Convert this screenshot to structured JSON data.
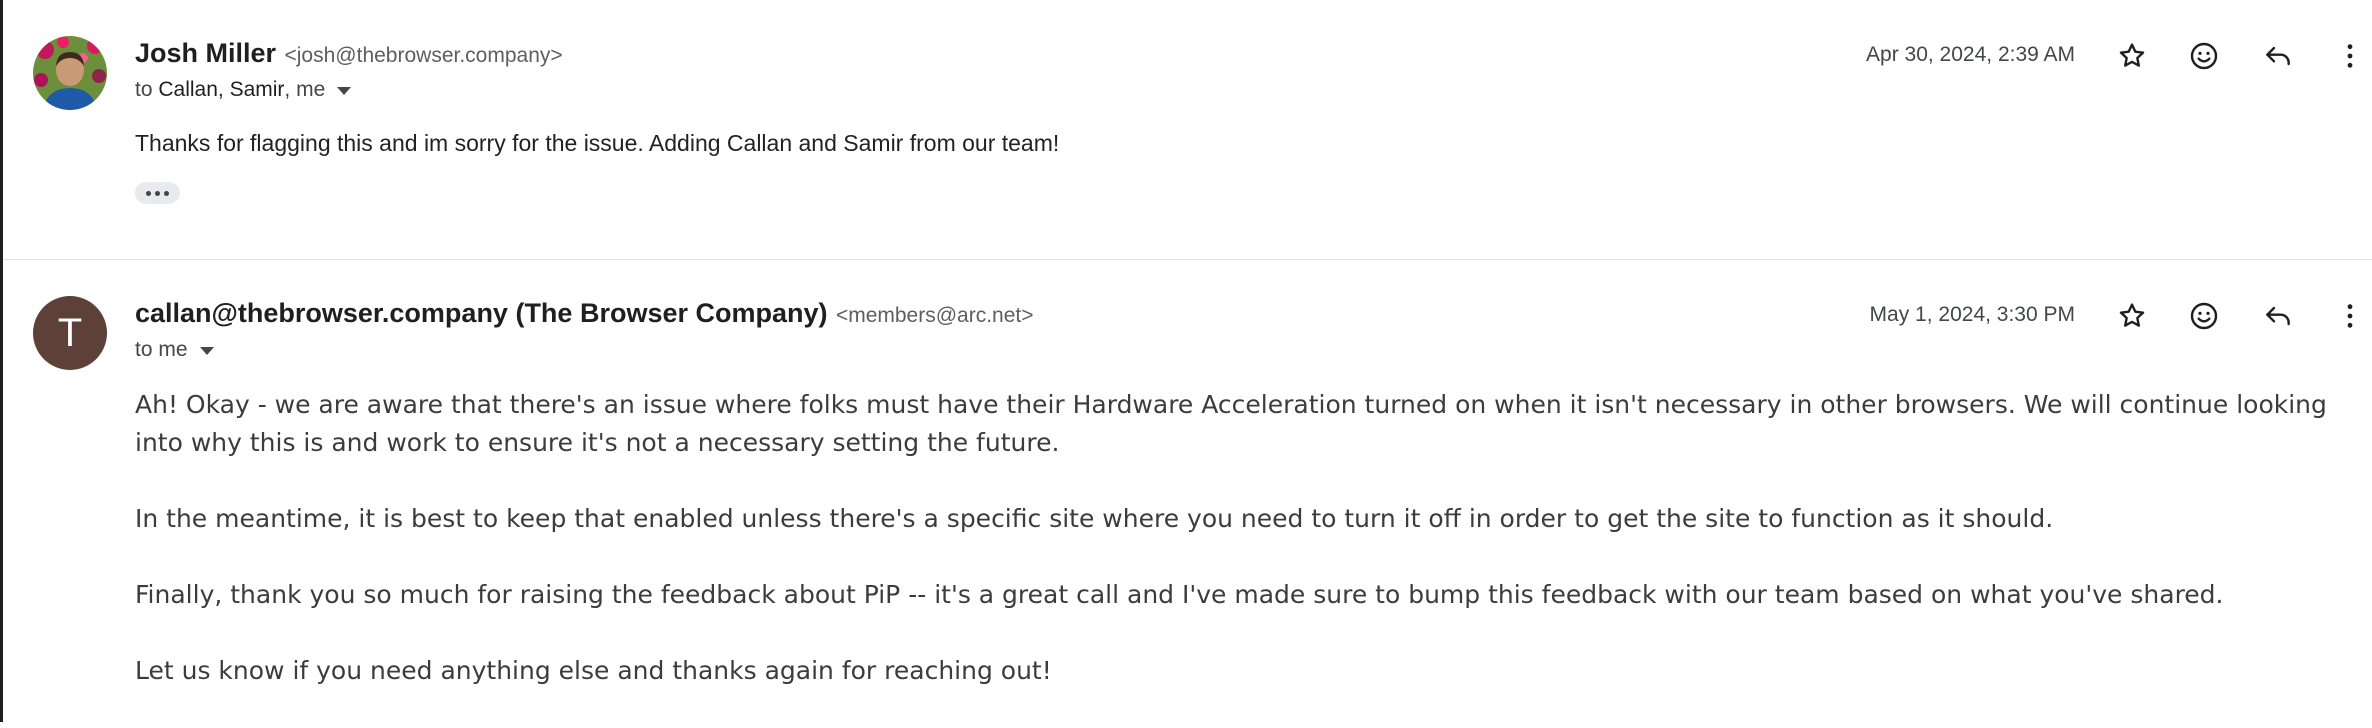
{
  "messages": [
    {
      "sender_name": "Josh Miller",
      "sender_email": "<josh@thebrowser.company>",
      "to_prefix": "to",
      "recipients": "Callan, Samir",
      "recipients_me": ", me",
      "date": "Apr 30, 2024, 2:39 AM",
      "body": "Thanks for flagging this and im sorry for the issue. Adding Callan and Samir from our team!",
      "avatar_icon": "profile-photo"
    },
    {
      "sender_name": "callan@thebrowser.company (The Browser Company)",
      "sender_email": "<members@arc.net>",
      "to_prefix": "to me",
      "date": "May 1, 2024, 3:30 PM",
      "avatar_letter": "T",
      "avatar_color": "#5d4037",
      "paragraphs": [
        "Ah! Okay - we are aware that there's an issue where folks must have their Hardware Acceleration turned on when it isn't necessary in other browsers. We will continue looking into why this is and work to ensure it's not a necessary setting the future.",
        "In the meantime, it is best to keep that enabled unless there's a specific site where you need to turn it off in order to get the site to function as it should.",
        "Finally, thank you so much for raising the feedback about PiP -- it's a great call and I've made sure to bump this feedback with our team based on what you've shared.",
        "Let us know if you need anything else and thanks again for reaching out!"
      ]
    }
  ],
  "icons": [
    "star-icon",
    "emoji-icon",
    "reply-icon",
    "more-vert-icon"
  ]
}
